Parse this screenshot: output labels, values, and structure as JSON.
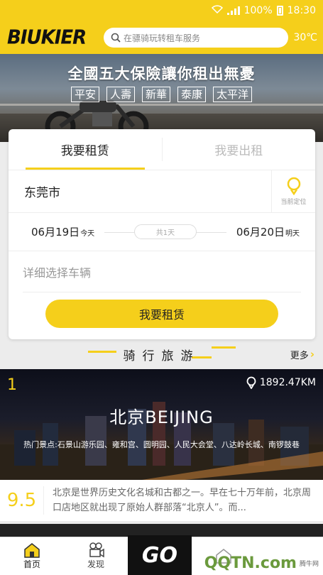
{
  "status_bar": {
    "battery": "100%",
    "time": "18:30"
  },
  "header": {
    "logo": "BIUKIER",
    "search_placeholder": "在骠骑玩转租车服务",
    "temperature": "30℃"
  },
  "banner": {
    "title": "全國五大保險讓你租出無憂",
    "insurers": [
      "平安",
      "人壽",
      "新華",
      "泰康",
      "太平洋"
    ]
  },
  "booking": {
    "tabs": [
      "我要租赁",
      "我要出租"
    ],
    "active_tab": 0,
    "city": "东莞市",
    "locate_label": "当前定位",
    "start_date": "06月19日",
    "start_tag": "今天",
    "duration": "共1天",
    "end_date": "06月20日",
    "end_tag": "明天",
    "vehicle_placeholder": "详细选择车辆",
    "submit_label": "我要租赁"
  },
  "section": {
    "title": "骑行旅游",
    "more_label": "更多"
  },
  "destination": {
    "rank": "1",
    "distance": "1892.47KM",
    "name": "北京BEIJING",
    "spots": "热门景点:石景山游乐园、雍和宫、圆明园、人民大会堂、八达岭长城、南锣鼓巷",
    "score": "9.5",
    "description": "北京是世界历史文化名城和古都之一。早在七十万年前，北京周口店地区就出现了原始人群部落“北京人”。而..."
  },
  "nav": {
    "items": [
      "首页",
      "发现",
      "",
      "",
      ""
    ],
    "center_logo": "GO"
  },
  "watermark": {
    "text": "QQTN.com",
    "sub": "腾牛网"
  },
  "colors": {
    "brand_yellow": "#f5cf1b"
  }
}
